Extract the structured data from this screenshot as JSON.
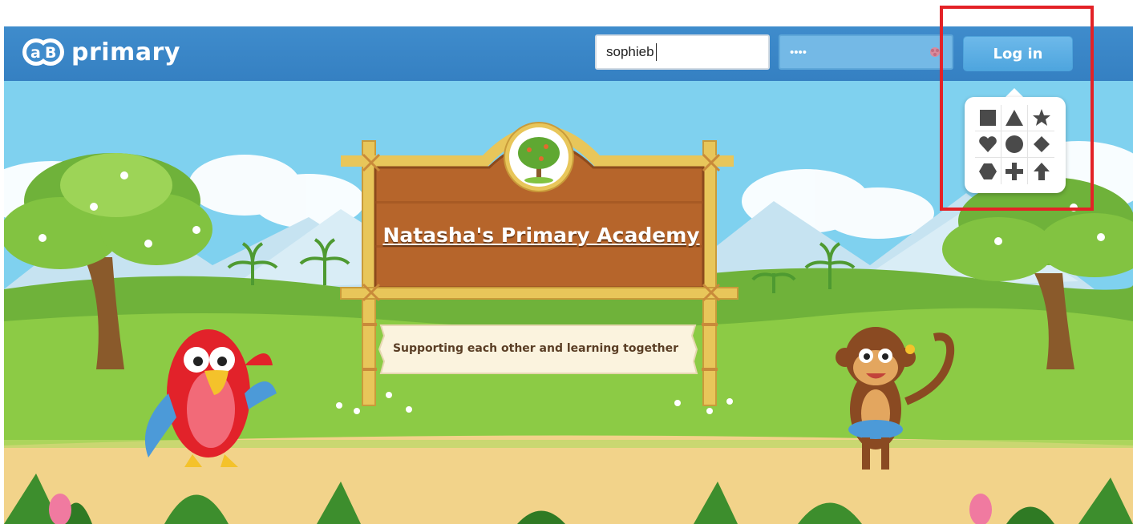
{
  "header": {
    "logo_text": "primary",
    "logo_badge_icon": "ab-logo-badge",
    "username_value": "sophieb",
    "password_value": "••••",
    "password_icon": "picture-hint-icon",
    "login_label": "Log in"
  },
  "school": {
    "name": "Natasha's Primary Academy",
    "motto": "Supporting each other and learning together",
    "crest_icon": "tree-crest-icon"
  },
  "picture_password": {
    "shapes": [
      "square",
      "triangle",
      "star",
      "heart",
      "circle",
      "diamond",
      "hexagon",
      "plus",
      "arrow-up"
    ]
  },
  "colors": {
    "header": "#3f8ccc",
    "login_button": "#5aaee3",
    "sky": "#7fd1ef",
    "grass": "#82c341",
    "path": "#f2d38a",
    "sign_wood": "#b6652b",
    "highlight": "#e32227",
    "shape_fill": "#4a4a4a"
  }
}
